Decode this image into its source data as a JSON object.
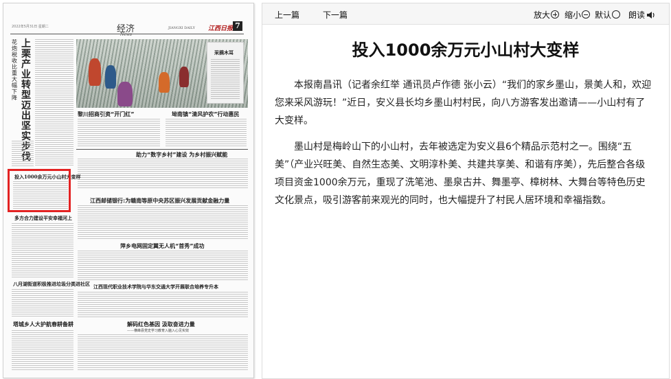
{
  "paper": {
    "date_line": "2022年5月31日 星期二",
    "section_title": "经济",
    "section_english": "News",
    "masthead_english": "JIANGXI DAILY",
    "masthead_logo": "江西日报",
    "page_number": "7",
    "vertical_headline": "上栗产业转型迈出坚实步伐",
    "vertical_subhead": "花炮税收比重大幅下降",
    "photo_caption": "采摘木耳",
    "headlines": {
      "left_top": "黎川招商引资“开门红”",
      "right_top": "坳南镇“清风护农”行动惠民",
      "banner1": "助力“数字乡村”建设 为乡村振兴赋能",
      "article_highlight": "投入1000余万元小山村大变样",
      "bank": "江西邮储银行:为赣南等原中央苏区振兴发展贡献金融力量",
      "safety": "多方合力建设平安幸福河上",
      "drone": "萍乡电网固定翼无人机“首秀”成功",
      "corn": "八月湖街道积极推进垃圾分类进社区",
      "college": "江西现代职业技术学院与华东交通大学开展联合培养专升本",
      "tea": "塔城乡人大护航春耕备耕",
      "red": "解码红色基因 汲取奋进力量",
      "red_sub": "——横峰县党史学习教育入脑入心见实效"
    }
  },
  "toolbar": {
    "prev": "上一篇",
    "next": "下一篇",
    "zoom_in": "放大",
    "zoom_out": "缩小",
    "default": "默认",
    "read_aloud": "朗读",
    "icons": [
      "zoom-in-icon",
      "zoom-out-icon",
      "default-icon",
      "speaker-icon"
    ]
  },
  "article": {
    "title": "投入1000余万元小山村大变样",
    "paragraphs": [
      "本报南昌讯（记者余红举 通讯员卢作德 张小云）“我们的家乡墨山，景美人和，欢迎您来采风游玩！”近日，安义县长均乡墨山村村民，向八方游客发出邀请——小山村有了大变样。",
      "墨山村是梅岭山下的小山村，去年被选定为安义县6个精品示范村之一。围绕“五美”（产业兴旺美、自然生态美、文明淳朴美、共建共享美、和谐有序美），先后整合各级项目资金1000余万元，重现了洗笔池、墨泉古井、舞墨亭、樟树林、大舞台等特色历史文化景点，吸引游客前来观光的同时，也大幅提升了村民人居环境和幸福指数。"
    ]
  },
  "colors": {
    "highlight": "#e32222",
    "toolbar_bg": "#f6f6f6"
  }
}
